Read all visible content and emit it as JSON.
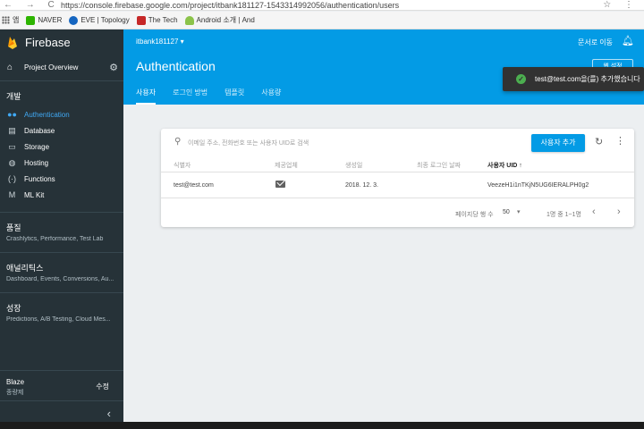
{
  "browser": {
    "nav_arrows": "← → C",
    "url": "https://console.firebase.google.com/project/itbank181127-1543314992056/authentication/users",
    "bookmarks": [
      {
        "label": "앱",
        "icon": "apps-grid-icon"
      },
      {
        "label": "NAVER",
        "icon": "naver-icon",
        "color": "#2db400"
      },
      {
        "label": "EVE | Topology",
        "icon": "eve-icon",
        "color": "#1565c0"
      },
      {
        "label": "The Tech",
        "icon": "the-tech-icon",
        "color": "#c62828"
      },
      {
        "label": "Android 소개 | And",
        "icon": "android-icon",
        "color": "#8bc34a"
      }
    ],
    "toolbar_icons": "☆ ⋮"
  },
  "sidebar": {
    "brand": "Firebase",
    "project_overview": "Project Overview",
    "section": "개발",
    "items": [
      {
        "label": "Authentication",
        "icon": "people-icon",
        "glyph": "👥",
        "active": true
      },
      {
        "label": "Database",
        "icon": "database-icon",
        "glyph": "▤",
        "active": false
      },
      {
        "label": "Storage",
        "icon": "storage-icon",
        "glyph": "▭",
        "active": false
      },
      {
        "label": "Hosting",
        "icon": "globe-icon",
        "glyph": "◍",
        "active": false
      },
      {
        "label": "Functions",
        "icon": "functions-icon",
        "glyph": "(...)",
        "active": false
      },
      {
        "label": "ML Kit",
        "icon": "ml-kit-icon",
        "glyph": "M",
        "active": false
      }
    ],
    "groups": [
      {
        "title": "품질",
        "sub": "Crashlytics, Performance, Test Lab"
      },
      {
        "title": "애널리틱스",
        "sub": "Dashboard, Events, Conversions, Au..."
      },
      {
        "title": "성장",
        "sub": "Predictions, A/B Testing, Cloud Mes..."
      }
    ],
    "plan": {
      "name": "Blaze",
      "sub": "종량제",
      "edit": "수정"
    },
    "collapse": "‹"
  },
  "header": {
    "project": "itbank181127 ▾",
    "docs": "문서로 이동",
    "title": "Authentication",
    "setup": "웹 설정",
    "tabs": [
      "사용자",
      "로그인 방법",
      "템플릿",
      "사용량"
    ]
  },
  "toast": {
    "message": "test@test.com을(를) 추가했습니다"
  },
  "users": {
    "search_placeholder": "이메일 주소, 전화번호 또는 사용자 UID로 검색",
    "add_user": "사용자 추가",
    "columns": [
      "식별자",
      "제공업체",
      "생성일",
      "최종 로그인 날짜",
      "사용자 UID ↑"
    ],
    "rows": [
      {
        "identifier": "test@test.com",
        "provider": "email-icon",
        "created": "2018. 12. 3.",
        "last_signin": "",
        "uid": "VeezeH1i1nTKjN5UG6IERALPH0g2"
      }
    ],
    "pager": {
      "label": "페이지당 행 수",
      "size": "50",
      "range": "1명 중 1~1명"
    }
  },
  "colors": {
    "accent": "#039be5",
    "sidebar": "#263238",
    "active_nav": "#40a9f4"
  }
}
